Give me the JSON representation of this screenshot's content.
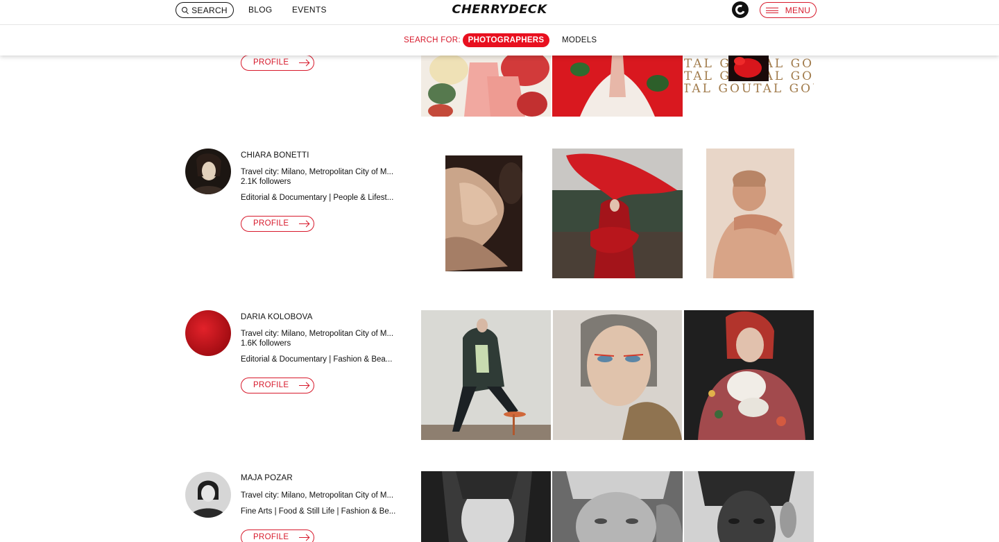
{
  "header": {
    "search_label": "SEARCH",
    "nav": {
      "blog": "BLOG",
      "events": "EVENTS"
    },
    "logo": "CHERRYDECK",
    "menu_label": "MENU",
    "search_for_label": "SEARCH FOR:",
    "filters": {
      "active": "PHOTOGRAPHERS",
      "other": "MODELS"
    }
  },
  "profile_button_label": "PROFILE",
  "decorative_text": {
    "goutal_row": "TAL GOUTAL GOUTAL GOUTAL"
  },
  "photographers": [
    {
      "name": "",
      "travel_city": "",
      "followers": "",
      "specialties": ""
    },
    {
      "name": "CHIARA BONETTI",
      "travel_city": "Travel city: Milano, Metropolitan City of M...",
      "followers": "2.1K followers",
      "specialties": "Editorial & Documentary | People & Lifest..."
    },
    {
      "name": "DARIA KOLOBOVA",
      "travel_city": "Travel city: Milano, Metropolitan City of M...",
      "followers": "1.6K followers",
      "specialties": "Editorial & Documentary | Fashion & Bea..."
    },
    {
      "name": "MAJA POZAR",
      "travel_city": "Travel city: Milano, Metropolitan City of M...",
      "followers": "",
      "specialties": "Fine Arts | Food & Still Life | Fashion & Be..."
    }
  ],
  "colors": {
    "accent": "#d7192b",
    "pill_active": "#e8101f",
    "text": "#111111"
  }
}
